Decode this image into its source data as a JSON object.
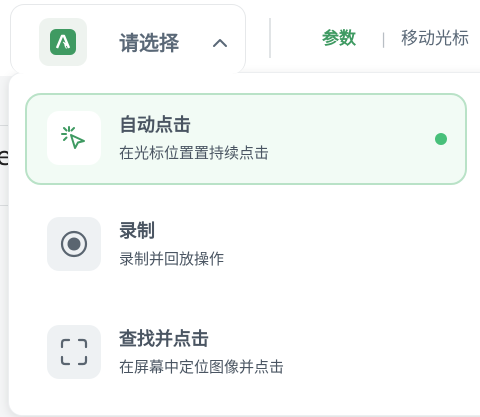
{
  "selector": {
    "label": "请选择",
    "expanded": true,
    "logo": "app-logo-icon"
  },
  "tabs": {
    "params": "参数",
    "separator": "|",
    "move_cursor": "移动光标"
  },
  "background": {
    "partial_char": "e"
  },
  "menu": {
    "items": [
      {
        "title": "自动点击",
        "description": "在光标位置置持续点击",
        "icon": "cursor-click-icon",
        "selected": true
      },
      {
        "title": "录制",
        "description": "录制并回放操作",
        "icon": "record-icon",
        "selected": false
      },
      {
        "title": "查找并点击",
        "description": "在屏幕中定位图像并点击",
        "icon": "scan-frame-icon",
        "selected": false
      }
    ]
  },
  "colors": {
    "accent": "#3f9a62",
    "selected_bg": "#f2fbf5",
    "selected_border": "#b9e2c7",
    "active_dot": "#48c07a",
    "text": "#4a5562"
  }
}
